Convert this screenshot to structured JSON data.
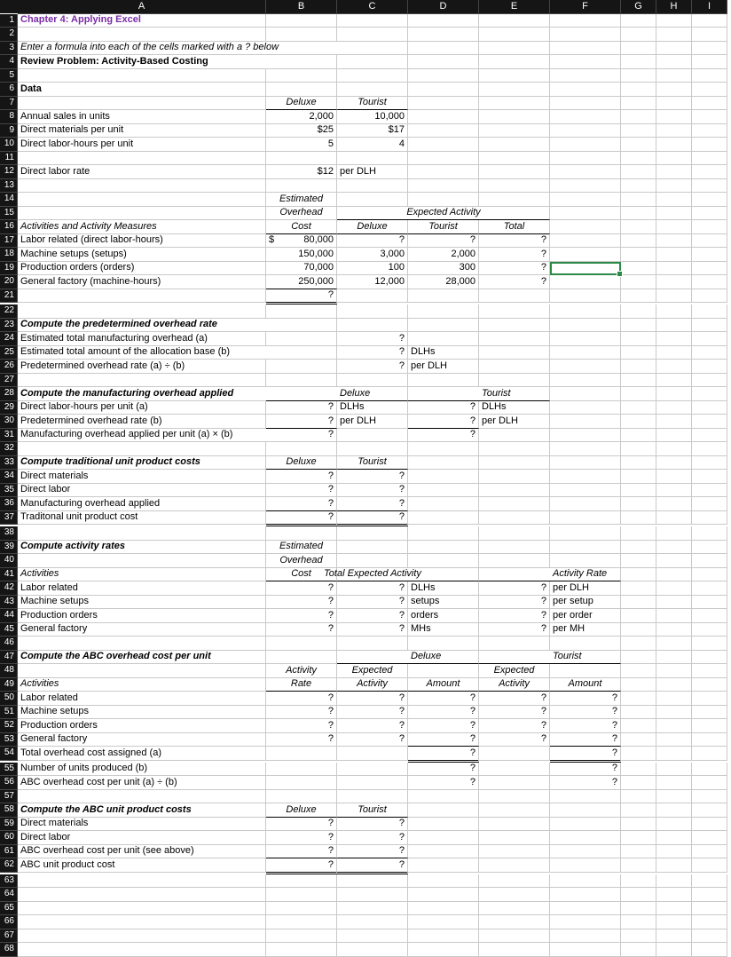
{
  "cols": [
    "A",
    "B",
    "C",
    "D",
    "E",
    "F",
    "G",
    "H",
    "I"
  ],
  "rows": [
    "1",
    "2",
    "3",
    "4",
    "5",
    "6",
    "7",
    "8",
    "9",
    "10",
    "11",
    "12",
    "13",
    "14",
    "15",
    "16",
    "17",
    "18",
    "19",
    "20",
    "21",
    "22",
    "23",
    "24",
    "25",
    "26",
    "27",
    "28",
    "29",
    "30",
    "31",
    "32",
    "33",
    "34",
    "35",
    "36",
    "37",
    "38",
    "39",
    "40",
    "41",
    "42",
    "43",
    "44",
    "45",
    "46",
    "47",
    "48",
    "49",
    "50",
    "51",
    "52",
    "53",
    "54",
    "55",
    "56",
    "57",
    "58",
    "59",
    "60",
    "61",
    "62",
    "63",
    "64",
    "65",
    "66",
    "67",
    "68"
  ],
  "r1": {
    "A": "Chapter 4: Applying Excel"
  },
  "r3": {
    "A": "Enter a formula into each of the cells marked with a ? below"
  },
  "r4": {
    "A": "Review Problem: Activity-Based Costing"
  },
  "r6": {
    "A": "Data"
  },
  "r7": {
    "B": "Deluxe",
    "C": "Tourist"
  },
  "r8": {
    "A": "Annual sales in units",
    "B": "2,000",
    "C": "10,000"
  },
  "r9": {
    "A": "Direct materials per unit",
    "B": "$25",
    "C": "$17"
  },
  "r10": {
    "A": "Direct labor-hours per unit",
    "B": "5",
    "C": "4"
  },
  "r12": {
    "A": "Direct labor rate",
    "B": "$12",
    "C": "per DLH"
  },
  "r14": {
    "B": "Estimated"
  },
  "r15": {
    "B": "Overhead",
    "DE": "Expected Activity"
  },
  "r16": {
    "A": "Activities and Activity Measures",
    "B": "Cost",
    "C": "Deluxe",
    "D": "Tourist",
    "E": "Total"
  },
  "r17": {
    "A": "Labor related (direct labor-hours)",
    "Bpre": "$",
    "B": "80,000",
    "C": "?",
    "D": "?",
    "E": "?"
  },
  "r18": {
    "A": "Machine setups (setups)",
    "B": "150,000",
    "C": "3,000",
    "D": "2,000",
    "E": "?"
  },
  "r19": {
    "A": "Production orders (orders)",
    "B": "70,000",
    "C": "100",
    "D": "300",
    "E": "?"
  },
  "r20": {
    "A": "General factory (machine-hours)",
    "B": "250,000",
    "C": "12,000",
    "D": "28,000",
    "E": "?"
  },
  "r21": {
    "B": "?"
  },
  "r23": {
    "A": "Compute the predetermined overhead rate"
  },
  "r24": {
    "A": "Estimated total manufacturing overhead (a)",
    "C": "?"
  },
  "r25": {
    "A": "Estimated total amount of the allocation base (b)",
    "C": "?",
    "D": "DLHs"
  },
  "r26": {
    "A": "Predetermined overhead rate (a) ÷ (b)",
    "C": "?",
    "D": "per DLH"
  },
  "r28": {
    "A": "Compute the manufacturing overhead applied",
    "BC": "Deluxe",
    "DE": "Tourist"
  },
  "r29": {
    "A": "Direct labor-hours per unit (a)",
    "B": "?",
    "C": "DLHs",
    "D": "?",
    "E": "DLHs"
  },
  "r30": {
    "A": "Predetermined overhead rate (b)",
    "B": "?",
    "C": "per DLH",
    "D": "?",
    "E": "per DLH"
  },
  "r31": {
    "A": "Manufacturing overhead applied per unit (a) × (b)",
    "B": "?",
    "D": "?"
  },
  "r33": {
    "A": "Compute traditional unit product costs",
    "B": "Deluxe",
    "C": "Tourist"
  },
  "r34": {
    "A": "Direct materials",
    "B": "?",
    "C": "?"
  },
  "r35": {
    "A": "Direct labor",
    "B": "?",
    "C": "?"
  },
  "r36": {
    "A": "Manufacturing overhead applied",
    "B": "?",
    "C": "?"
  },
  "r37": {
    "A": "Traditonal unit product cost",
    "B": "?",
    "C": "?"
  },
  "r39": {
    "A": "Compute activity rates",
    "B": "Estimated"
  },
  "r40": {
    "B": "Overhead"
  },
  "r41": {
    "A": "Activities",
    "B": "Cost",
    "CD": "Total Expected Activity",
    "EF": "Activity Rate"
  },
  "r42": {
    "A": "Labor related",
    "B": "?",
    "C": "?",
    "D": "DLHs",
    "E": "?",
    "F": "per DLH"
  },
  "r43": {
    "A": "Machine setups",
    "B": "?",
    "C": "?",
    "D": "setups",
    "E": "?",
    "F": "per setup"
  },
  "r44": {
    "A": "Production orders",
    "B": "?",
    "C": "?",
    "D": "orders",
    "E": "?",
    "F": "per order"
  },
  "r45": {
    "A": "General factory",
    "B": "?",
    "C": "?",
    "D": "MHs",
    "E": "?",
    "F": "per MH"
  },
  "r47": {
    "A": "Compute the ABC overhead cost per unit",
    "CD": "Deluxe",
    "EF": "Tourist"
  },
  "r48": {
    "B": "Activity",
    "C": "Expected",
    "E": "Expected"
  },
  "r49": {
    "A": "Activities",
    "B": "Rate",
    "C": "Activity",
    "D": "Amount",
    "E": "Activity",
    "F": "Amount"
  },
  "r50": {
    "A": "Labor related",
    "B": "?",
    "C": "?",
    "D": "?",
    "E": "?",
    "F": "?"
  },
  "r51": {
    "A": "Machine setups",
    "B": "?",
    "C": "?",
    "D": "?",
    "E": "?",
    "F": "?"
  },
  "r52": {
    "A": "Production orders",
    "B": "?",
    "C": "?",
    "D": "?",
    "E": "?",
    "F": "?"
  },
  "r53": {
    "A": "General factory",
    "B": "?",
    "C": "?",
    "D": "?",
    "E": "?",
    "F": "?"
  },
  "r54": {
    "A": "Total overhead cost assigned (a)",
    "D": "?",
    "F": "?"
  },
  "r55": {
    "A": "Number of units produced (b)",
    "D": "?",
    "F": "?"
  },
  "r56": {
    "A": "ABC overhead cost per unit (a) ÷ (b)",
    "D": "?",
    "F": "?"
  },
  "r58": {
    "A": "Compute the ABC unit product costs",
    "B": "Deluxe",
    "C": "Tourist"
  },
  "r59": {
    "A": "Direct materials",
    "B": "?",
    "C": "?"
  },
  "r60": {
    "A": "Direct labor",
    "B": "?",
    "C": "?"
  },
  "r61": {
    "A": "ABC overhead cost per unit (see above)",
    "B": "?",
    "C": "?"
  },
  "r62": {
    "A": "ABC unit product cost",
    "B": "?",
    "C": "?"
  }
}
